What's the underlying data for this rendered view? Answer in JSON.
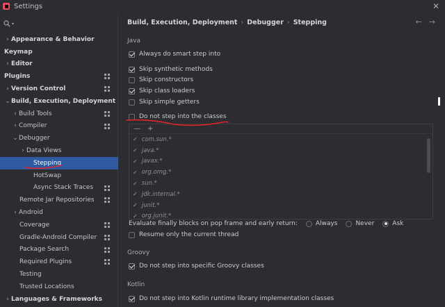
{
  "window": {
    "title": "Settings",
    "close_icon": "close-icon"
  },
  "search": {
    "placeholder": "",
    "value": ""
  },
  "sidebar": {
    "items": [
      {
        "label": "Appearance & Behavior",
        "arrow": "›",
        "bold": true,
        "indent": 0,
        "grid": false
      },
      {
        "label": "Keymap",
        "arrow": "",
        "bold": true,
        "indent": 0,
        "grid": false
      },
      {
        "label": "Editor",
        "arrow": "›",
        "bold": true,
        "indent": 0,
        "grid": false
      },
      {
        "label": "Plugins",
        "arrow": "",
        "bold": true,
        "indent": 0,
        "grid": true
      },
      {
        "label": "Version Control",
        "arrow": "›",
        "bold": true,
        "indent": 0,
        "grid": true
      },
      {
        "label": "Build, Execution, Deployment",
        "arrow": "⌄",
        "bold": true,
        "indent": 0,
        "grid": false
      },
      {
        "label": "Build Tools",
        "arrow": "›",
        "bold": false,
        "indent": 1,
        "grid": true
      },
      {
        "label": "Compiler",
        "arrow": "›",
        "bold": false,
        "indent": 1,
        "grid": true
      },
      {
        "label": "Debugger",
        "arrow": "⌄",
        "bold": false,
        "indent": 1,
        "grid": false
      },
      {
        "label": "Data Views",
        "arrow": "›",
        "bold": false,
        "indent": 2,
        "grid": false
      },
      {
        "label": "Stepping",
        "arrow": "",
        "bold": false,
        "indent": 3,
        "grid": false,
        "selected": true
      },
      {
        "label": "HotSwap",
        "arrow": "",
        "bold": false,
        "indent": 3,
        "grid": false
      },
      {
        "label": "Async Stack Traces",
        "arrow": "",
        "bold": false,
        "indent": 3,
        "grid": true
      },
      {
        "label": "Remote Jar Repositories",
        "arrow": "",
        "bold": false,
        "indent": 2,
        "grid": true
      },
      {
        "label": "Android",
        "arrow": "›",
        "bold": false,
        "indent": 1,
        "grid": false
      },
      {
        "label": "Coverage",
        "arrow": "",
        "bold": false,
        "indent": 2,
        "grid": true
      },
      {
        "label": "Gradle-Android Compiler",
        "arrow": "",
        "bold": false,
        "indent": 2,
        "grid": true
      },
      {
        "label": "Package Search",
        "arrow": "",
        "bold": false,
        "indent": 2,
        "grid": true
      },
      {
        "label": "Required Plugins",
        "arrow": "",
        "bold": false,
        "indent": 2,
        "grid": true
      },
      {
        "label": "Testing",
        "arrow": "",
        "bold": false,
        "indent": 2,
        "grid": false
      },
      {
        "label": "Trusted Locations",
        "arrow": "",
        "bold": false,
        "indent": 2,
        "grid": false
      },
      {
        "label": "Languages & Frameworks",
        "arrow": "›",
        "bold": true,
        "indent": 0,
        "grid": false
      }
    ]
  },
  "breadcrumb": {
    "part1": "Build, Execution, Deployment",
    "part2": "Debugger",
    "part3": "Stepping",
    "sep": "›",
    "back": "←",
    "forward": "→"
  },
  "java": {
    "section": "Java",
    "always_smart_step": "Always do smart step into",
    "skip_synthetic": "Skip synthetic methods",
    "skip_constructors": "Skip constructors",
    "skip_class_loaders": "Skip class loaders",
    "skip_getters": "Skip simple getters",
    "do_not_step_into": "Do not step into the classes",
    "add_label": "+",
    "remove_label": "—",
    "classes": [
      "com.sun.*",
      "java.*",
      "javax.*",
      "org.omg.*",
      "sun.*",
      "jdk.internal.*",
      "junit.*",
      "org.junit.*"
    ],
    "evaluate_finally": "Evaluate finally blocks on pop frame and early return:",
    "opt_always": "Always",
    "opt_never": "Never",
    "opt_ask": "Ask",
    "resume_only": "Resume only the current thread"
  },
  "groovy": {
    "section": "Groovy",
    "do_not_step": "Do not step into specific Groovy classes"
  },
  "kotlin": {
    "section": "Kotlin",
    "do_not_step": "Do not step into Kotlin runtime library implementation classes"
  },
  "annotations": {
    "color": "#e3222c"
  }
}
